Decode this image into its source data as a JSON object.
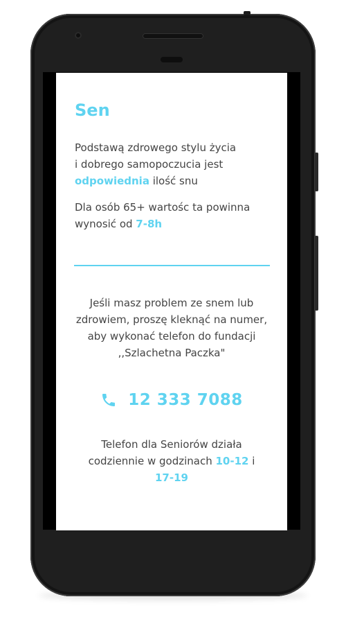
{
  "screen": {
    "title": "Sen",
    "paragraph1": {
      "line1": "Podstawą zdrowego stylu życia",
      "line2": "i dobrego samopoczucia jest",
      "highlight": "odpowiednia",
      "rest": " ilość snu"
    },
    "paragraph2": {
      "line1": "Dla osób 65+ wartośc ta powinna",
      "line2_prefix": "wynosić od ",
      "highlight": "7-8h"
    },
    "info_text": "Jeśli masz problem ze snem lub zdrowiem, proszę kleknąć na numer, aby wykonać telefon do fundacji ,,Szlachetna Paczka\"",
    "phone": {
      "icon": "phone-icon",
      "number": "12 333 7088"
    },
    "footer": {
      "prefix": "Telefon dla Seniorów działa codziennie w godzinach ",
      "hours1": "10-12",
      "middle": " i ",
      "hours2": "17-19"
    }
  },
  "colors": {
    "accent": "#5fd3f0",
    "text": "#444444",
    "device": "#1f1f1f"
  }
}
